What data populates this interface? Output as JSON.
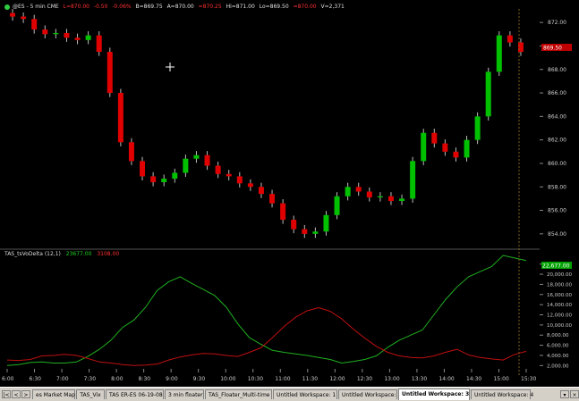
{
  "header": {
    "symbol": "@ES - 5 min CME",
    "last": "L=870.00",
    "change": "-0.50",
    "pct": "-0.06%",
    "bid": "B=869.75",
    "ask": "A=870.00",
    "ask2": "=870.25",
    "hi": "Hi=871.00",
    "lo": "Lo=869.50",
    "o": "=870.00",
    "vol": "V=2,371"
  },
  "price_axis": {
    "ticks": [
      "872.00",
      "870.00",
      "868.00",
      "866.00",
      "864.00",
      "862.00",
      "860.00",
      "858.00",
      "856.00",
      "854.00"
    ],
    "last_label": "869.50"
  },
  "indicator": {
    "name": "TAS_tsVoDelta (12,1)",
    "val1": "23677.00",
    "val2": "3108.00",
    "last_label": "22,677.00",
    "ticks": [
      "22,000.00",
      "20,000.00",
      "18,000.00",
      "16,000.00",
      "14,000.00",
      "12,000.00",
      "10,000.00",
      "8,000.00",
      "6,000.00",
      "4,000.00",
      "2,000.00"
    ]
  },
  "time_axis": [
    "6:00",
    "6:30",
    "7:00",
    "7:30",
    "8:00",
    "8:30",
    "9:00",
    "9:30",
    "10:00",
    "10:30",
    "11:00",
    "11:30",
    "12:00",
    "12:30",
    "13:00",
    "13:30",
    "14:00",
    "14:30",
    "15:00",
    "15:30"
  ],
  "tabs": [
    {
      "label": "es Market Map",
      "active": false
    },
    {
      "label": "TAS_Vix",
      "active": false
    },
    {
      "label": "TAS ER-ES 06-19-08",
      "active": false
    },
    {
      "label": "3 min floater",
      "active": false
    },
    {
      "label": "TAS_Floater_Multi-time",
      "active": false
    },
    {
      "label": "Untitled Workspace: 1",
      "active": false
    },
    {
      "label": "Untitled Workspace: 2",
      "active": false
    },
    {
      "label": "Untitled Workspace: 3",
      "active": true
    },
    {
      "label": "Untitled Workspace: 4",
      "active": false
    }
  ],
  "colors": {
    "up": "#00c000",
    "down": "#e00000",
    "price_marker": "#c00000",
    "ind_marker": "#00a000",
    "green_line": "#20b020",
    "red_line": "#c01010"
  },
  "chart_data": [
    {
      "type": "candlestick",
      "ylim": [
        853,
        873
      ],
      "x": [
        "6:00",
        "6:30",
        "7:00",
        "7:30",
        "8:00",
        "8:30",
        "9:00",
        "9:30",
        "10:00",
        "10:30",
        "11:00",
        "11:30",
        "12:00",
        "12:30",
        "13:00",
        "13:30",
        "14:00",
        "14:30",
        "15:00",
        "15:30"
      ],
      "close": [
        872.5,
        872.3,
        871.4,
        871.0,
        871.1,
        870.7,
        870.5,
        870.9,
        869.5,
        866.0,
        861.8,
        860.2,
        858.9,
        858.4,
        858.7,
        859.2,
        860.4,
        860.7,
        859.8,
        859.1,
        858.9,
        858.3,
        858.0,
        857.4,
        856.6,
        855.2,
        854.4,
        854.0,
        854.2,
        855.6,
        857.2,
        858.0,
        857.6,
        857.1,
        857.2,
        856.8,
        857.0,
        860.2,
        862.6,
        861.7,
        861.0,
        860.5,
        862.0,
        864.0,
        867.8,
        870.9,
        870.3,
        869.5
      ]
    },
    {
      "type": "line",
      "ylim": [
        1000,
        23000
      ],
      "series": [
        {
          "name": "",
          "values": [
            2000,
            2200,
            2600,
            2700,
            2500,
            2500,
            2700,
            3800,
            5200,
            7000,
            9500,
            11000,
            13500,
            16800,
            18500,
            19500,
            18200,
            17000,
            15800,
            13500,
            10200,
            7500,
            6200,
            5000,
            4600,
            4300,
            4000,
            3600,
            3200,
            2500,
            2800,
            3200,
            3900,
            5600,
            7000,
            8000,
            9000,
            12000,
            15000,
            17500,
            19500,
            20500,
            21500,
            23700,
            23200,
            22700
          ]
        },
        {
          "name": "",
          "values": [
            3100,
            3000,
            3200,
            3900,
            4000,
            4200,
            4000,
            3400,
            2700,
            2500,
            2200,
            2000,
            2100,
            2300,
            3100,
            3700,
            4100,
            4400,
            4300,
            4000,
            3800,
            4600,
            5500,
            7500,
            9700,
            11500,
            12800,
            13400,
            12700,
            11200,
            9200,
            7400,
            5800,
            4600,
            3900,
            3600,
            3500,
            3900,
            4600,
            5200,
            4100,
            3600,
            3300,
            3100,
            4200,
            4800
          ]
        }
      ]
    }
  ]
}
